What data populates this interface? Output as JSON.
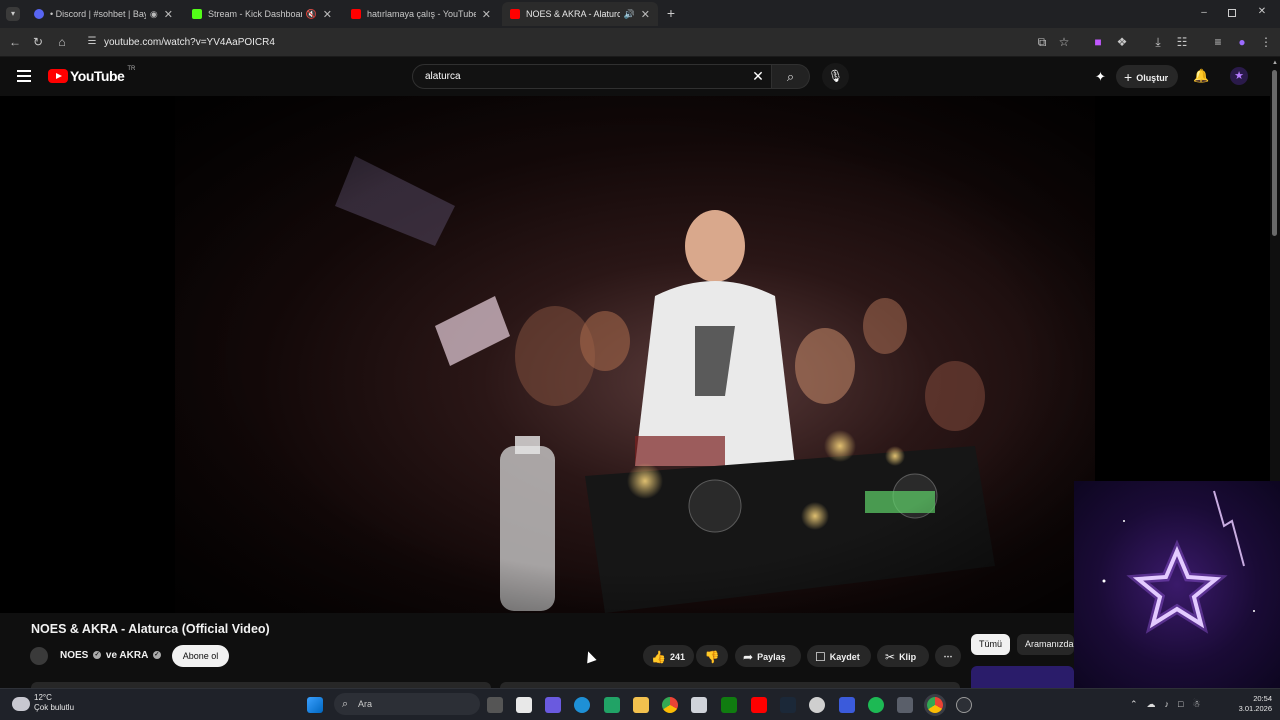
{
  "browser": {
    "tabs": [
      {
        "title": "• Discord | #sohbet | BayYT",
        "fav_color": "#5865f2"
      },
      {
        "title": "Stream - Kick Dashboard",
        "fav_color": "#53fc18"
      },
      {
        "title": "hatırlamaya çalış - YouTube",
        "fav_color": "#ff0000"
      },
      {
        "title": "NOES & AKRA - Alaturca (C",
        "fav_color": "#ff0000"
      }
    ],
    "url": "youtube.com/watch?v=YV4AaPOICR4"
  },
  "youtube": {
    "logo_text": "YouTube",
    "region": "TR",
    "search_query": "alaturca",
    "create_label": "Oluştur"
  },
  "video": {
    "title": "NOES & AKRA - Alaturca (Official Video)",
    "channel": "NOES",
    "channel_joiner": "ve AKRA",
    "subscribe_label": "Abone ol",
    "likes": "241",
    "share_label": "Paylaş",
    "save_label": "Kaydet",
    "clip_label": "Klip"
  },
  "chips": {
    "all": "Tümü",
    "search": "Aramanızda"
  },
  "taskbar": {
    "temp": "12°C",
    "weather": "Çok bulutlu",
    "search": "Ara",
    "time": "20:54",
    "date": "3.01.2026"
  }
}
